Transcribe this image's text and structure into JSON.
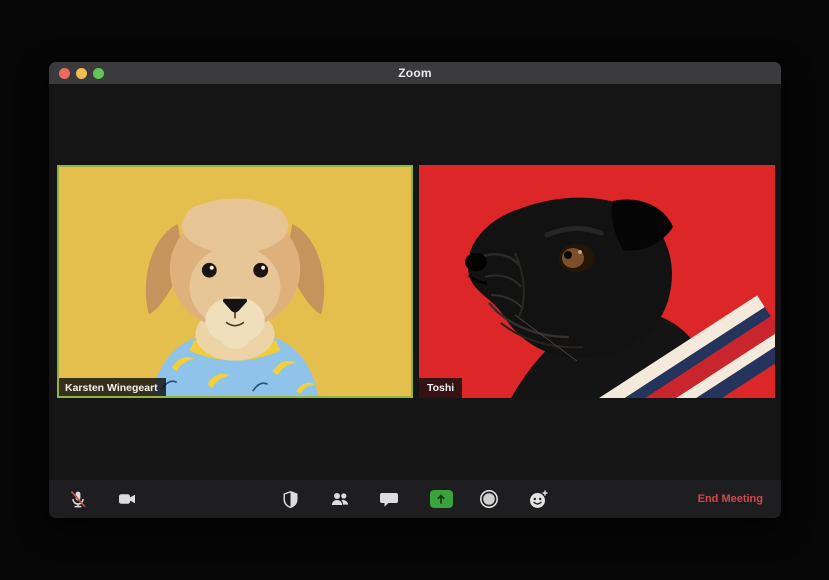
{
  "window": {
    "title": "Zoom",
    "controls": [
      {
        "name": "close",
        "color": "#ec6a5e"
      },
      {
        "name": "minimize",
        "color": "#f5bd4f"
      },
      {
        "name": "zoom",
        "color": "#61c454"
      }
    ]
  },
  "participants": [
    {
      "name": "Karsten Winegeart",
      "background_color": "#e4bf4d",
      "active_speaker": true,
      "video_content": "tan fluffy dog facing camera wearing blue banana-print shirt on yellow backdrop"
    },
    {
      "name": "Toshi",
      "background_color": "#dc2627",
      "active_speaker": false,
      "video_content": "black pug in side profile wearing white-navy-red striped sweater on red backdrop"
    }
  ],
  "toolbar": {
    "buttons": [
      {
        "icon": "microphone-muted-icon",
        "state": "muted"
      },
      {
        "icon": "video-camera-icon",
        "state": "on"
      },
      {
        "icon": "security-shield-icon"
      },
      {
        "icon": "participants-icon"
      },
      {
        "icon": "chat-icon"
      },
      {
        "icon": "share-screen-icon",
        "accent_color": "#3aa33c"
      },
      {
        "icon": "record-icon"
      },
      {
        "icon": "reactions-icon"
      }
    ],
    "end_meeting_label": "End Meeting",
    "end_meeting_color": "#d0494a"
  },
  "colors": {
    "desktop_background": "#060606",
    "window_background": "#151515",
    "titlebar": "#3b3b3d",
    "toolbar": "#1e1e20",
    "active_speaker_border": "#93b33f",
    "icon": "#dcdcdc"
  }
}
